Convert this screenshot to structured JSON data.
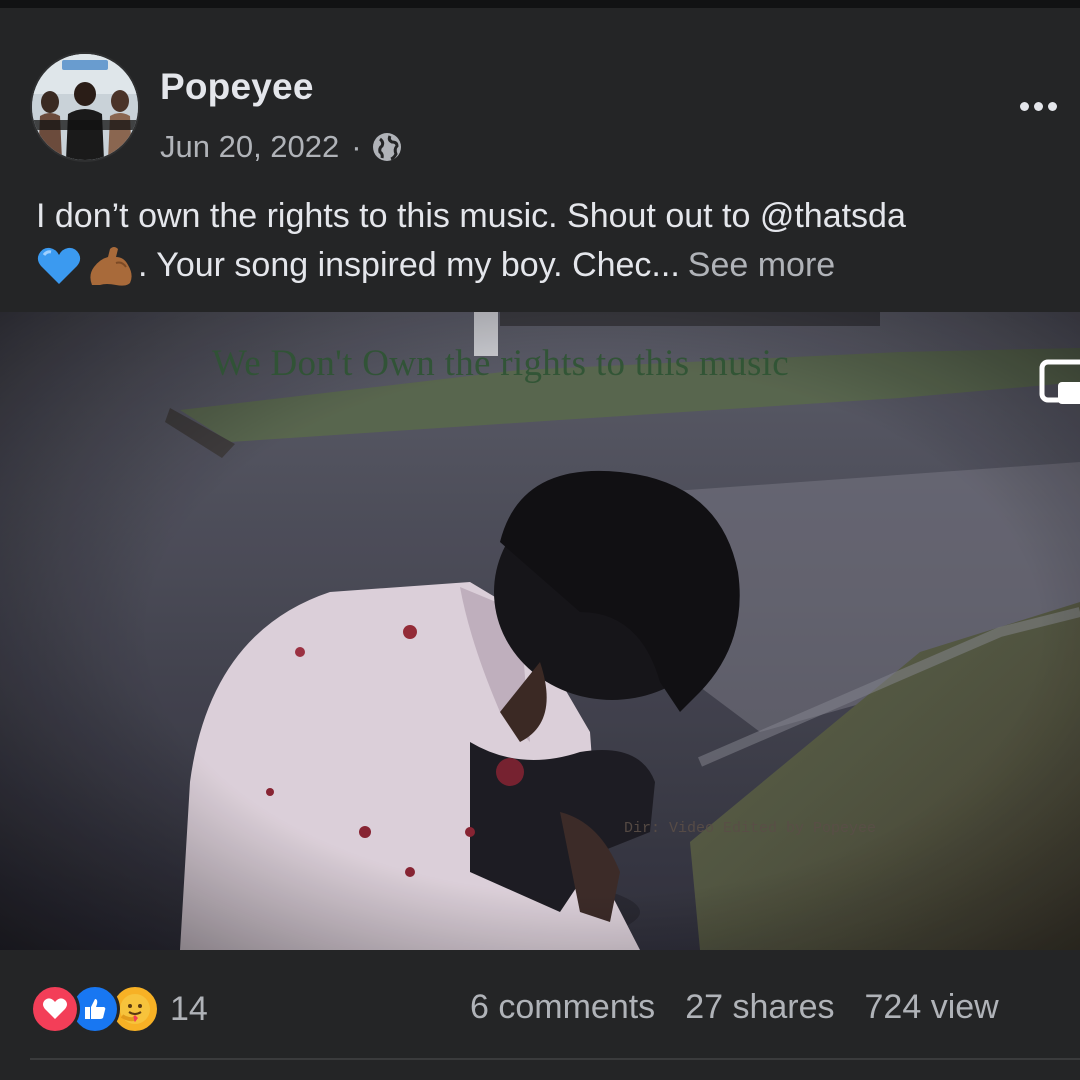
{
  "post": {
    "author": "Popeyee",
    "date": "Jun 20, 2022",
    "separator": "·",
    "audience_icon": "globe-icon",
    "caption_line1": "I don’t own the rights to this music. Shout out to @thatsda",
    "caption_line2": ". Your song inspired my boy. Chec...",
    "see_more": "See more",
    "caption_emojis": [
      "blue-heart-icon",
      "flexed-biceps-icon"
    ]
  },
  "video": {
    "overlay_text": "We Don't Own the rights to this music",
    "credit": "Dir: Video Edited by Popeyee",
    "controls": [
      "pip-icon"
    ]
  },
  "footer": {
    "reaction_icons": [
      "love-icon",
      "like-icon",
      "care-icon"
    ],
    "reaction_count": "14",
    "comments": "6 comments",
    "shares": "27 shares",
    "views": "724 view"
  },
  "colors": {
    "background": "#242526",
    "primary_text": "#e4e6eb",
    "secondary_text": "#b0b3b8",
    "love": "#f33e58",
    "like": "#1877f2",
    "care": "#f7b125"
  }
}
